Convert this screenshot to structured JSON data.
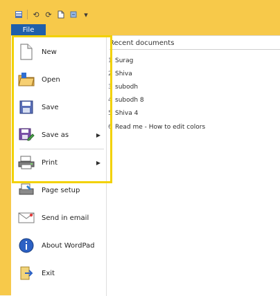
{
  "title_bar": {
    "quick_access_icons": [
      "wordpad-app-icon",
      "undo-icon",
      "redo-icon",
      "new-document-icon",
      "properties-icon",
      "customize-qat-icon"
    ]
  },
  "ribbon": {
    "file_tab_label": "File"
  },
  "file_menu": {
    "items": [
      {
        "label": "New",
        "icon": "new-document-icon"
      },
      {
        "label": "Open",
        "icon": "open-folder-icon"
      },
      {
        "label": "Save",
        "icon": "save-disk-icon"
      },
      {
        "label": "Save as",
        "icon": "save-as-icon",
        "has_submenu": true
      },
      {
        "label": "Print",
        "icon": "printer-icon",
        "has_submenu": true
      },
      {
        "label": "Page setup",
        "icon": "page-setup-icon"
      },
      {
        "label": "Send in email",
        "icon": "email-icon"
      },
      {
        "label": "About WordPad",
        "icon": "info-icon"
      },
      {
        "label": "Exit",
        "icon": "exit-icon"
      }
    ]
  },
  "recent": {
    "title": "Recent documents",
    "items": [
      {
        "index": "1",
        "name": "Surag"
      },
      {
        "index": "2",
        "name": "Shiva"
      },
      {
        "index": "3",
        "name": "subodh"
      },
      {
        "index": "4",
        "name": "subodh 8"
      },
      {
        "index": "5",
        "name": "Shiva 4"
      },
      {
        "index": "6",
        "name": "Read me - How to edit colors"
      }
    ]
  },
  "colors": {
    "highlight": "#f2d100",
    "file_tab": "#1f5faa",
    "window_frame": "#f7c94a"
  }
}
